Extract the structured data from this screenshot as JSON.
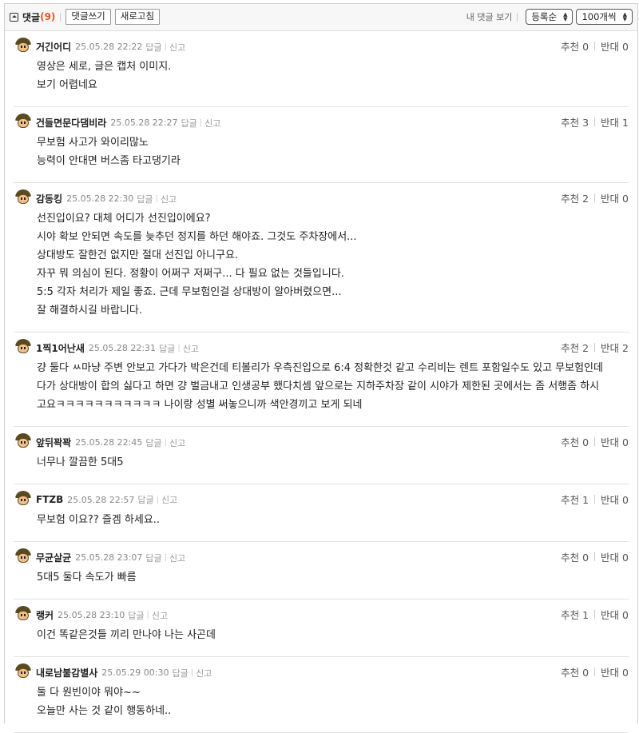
{
  "toolbar": {
    "title": "댓글",
    "count": "(9)",
    "write_label": "댓글쓰기",
    "refresh_label": "새로고침",
    "my_comments_label": "내 댓글 보기",
    "sort_selected": "등록순",
    "page_size_selected": "100개씩"
  },
  "labels": {
    "reply": "답글",
    "report": "신고",
    "up": "추천",
    "down": "반대"
  },
  "colors": {
    "count": "#e8541e",
    "border": "#cfcfcf",
    "toolbar_bg": "#f7f7f7"
  },
  "comments": [
    {
      "nick": "거긴어디",
      "date": "25.05.28 22:22",
      "up": "0",
      "down": "0",
      "avatar": "avatar-icon",
      "lines": [
        "영상은 세로, 글은 캡처 이미지.",
        "보기 어렵네요"
      ]
    },
    {
      "nick": "건들면문다댐비라",
      "date": "25.05.28 22:27",
      "up": "3",
      "down": "1",
      "avatar": "avatar-icon",
      "lines": [
        "무보험 사고가 와이리많노",
        "능력이 안대면 버스좀 타고댕기라"
      ]
    },
    {
      "nick": "감동킹",
      "date": "25.05.28 22:30",
      "up": "2",
      "down": "0",
      "avatar": "avatar-icon",
      "lines": [
        "선진입이요? 대체 어디가 선진입이에요?",
        "시야 확보 안되면 속도를 늦추던 정지를 하던 해야죠. 그것도 주차장에서...",
        "상대방도 잘한건 없지만 절대 선진입 아니구요.",
        "자꾸 뭐 의심이 된다. 정황이 어쩌구 저쩌구... 다 필요 없는 것들입니다.",
        "5:5 각자 처리가 제일 좋죠. 근데 무보험인걸 상대방이 알아버렸으면...",
        "잘 해결하시길 바랍니다."
      ]
    },
    {
      "nick": "1찍1어난새",
      "date": "25.05.28 22:31",
      "up": "2",
      "down": "2",
      "avatar": "avatar-icon",
      "lines": [
        "걍 둘다 ㅆ마냥 주변 안보고 가다가 박은건데 티볼리가 우측진입으로 6:4 정확한것 같고 수리비는 렌트 포함일수도 있고 무보험인데",
        "다가 상대방이 합의 싫다고 하면 걍 벌금내고 인생공부 했다치셈 앞으로는 지하주차장 같이 시야가 제한된 곳에서는 좀 서행좀 하시",
        "고요ㅋㅋㅋㅋㅋㅋㅋㅋㅋㅋㅋ 나이랑 성별 써놓으니까 색안경끼고 보게 되네"
      ]
    },
    {
      "nick": "앞뒤꽉꽉",
      "date": "25.05.28 22:45",
      "up": "0",
      "down": "0",
      "avatar": "avatar-icon",
      "lines": [
        "너무나 깔끔한 5대5"
      ]
    },
    {
      "nick": "FTZB",
      "date": "25.05.28 22:57",
      "up": "1",
      "down": "0",
      "avatar": "avatar-icon",
      "lines": [
        "무보험 이요?? 즐겜 하세요.."
      ]
    },
    {
      "nick": "무균살균",
      "date": "25.05.28 23:07",
      "up": "0",
      "down": "0",
      "avatar": "avatar-icon",
      "lines": [
        "5대5 둘다 속도가 빠름"
      ]
    },
    {
      "nick": "랭커",
      "date": "25.05.28 23:10",
      "up": "1",
      "down": "0",
      "avatar": "avatar-icon",
      "lines": [
        "이건 똑같은것들 끼리 만나야 나는 사곤데"
      ]
    },
    {
      "nick": "내로남불감별사",
      "date": "25.05.29 00:30",
      "up": "0",
      "down": "0",
      "avatar": "avatar-icon",
      "lines": [
        "둘 다 원빈이야 뭐야~~",
        "오늘만 사는 것 같이 행동하네.."
      ]
    }
  ]
}
